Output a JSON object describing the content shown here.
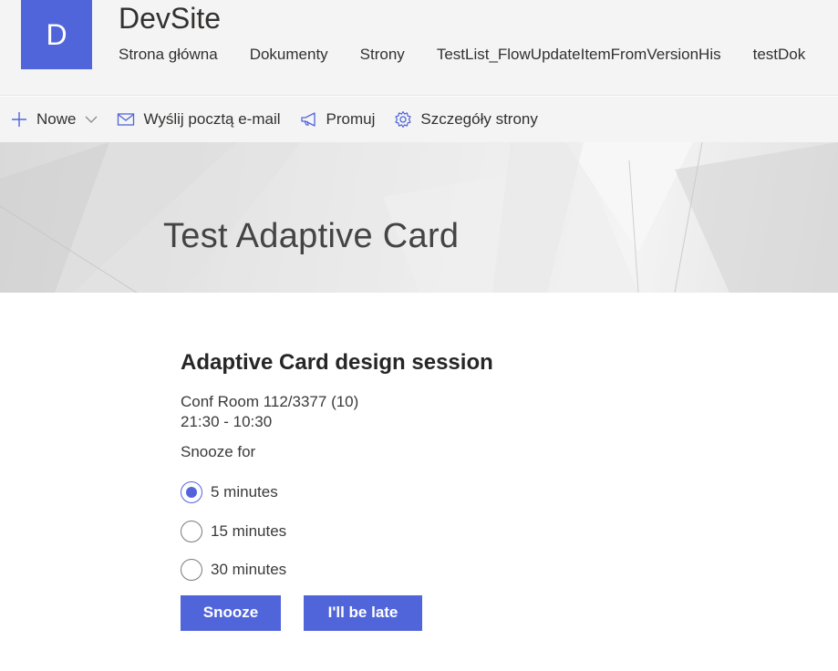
{
  "site": {
    "logo_letter": "D",
    "title": "DevSite",
    "nav": [
      {
        "label": "Strona główna"
      },
      {
        "label": "Dokumenty"
      },
      {
        "label": "Strony"
      },
      {
        "label": "TestList_FlowUpdateItemFromVersionHis"
      },
      {
        "label": "testDok"
      }
    ]
  },
  "commands": {
    "new": {
      "label": "Nowe",
      "icon": "plus-icon"
    },
    "email": {
      "label": "Wyślij pocztą e-mail",
      "icon": "mail-icon"
    },
    "promote": {
      "label": "Promuj",
      "icon": "megaphone-icon"
    },
    "details": {
      "label": "Szczegóły strony",
      "icon": "gear-icon"
    }
  },
  "page": {
    "title": "Test Adaptive Card"
  },
  "card": {
    "title": "Adaptive Card design session",
    "location": "Conf Room 112/3377 (10)",
    "time": "21:30 - 10:30",
    "snooze_label": "Snooze for",
    "options": [
      {
        "label": "5 minutes",
        "checked": true
      },
      {
        "label": "15 minutes",
        "checked": false
      },
      {
        "label": "30 minutes",
        "checked": false
      }
    ],
    "buttons": {
      "snooze": "Snooze",
      "late": "I'll be late"
    }
  },
  "colors": {
    "accent": "#5165db",
    "header_bg": "#f4f4f4",
    "text": "#323130"
  }
}
